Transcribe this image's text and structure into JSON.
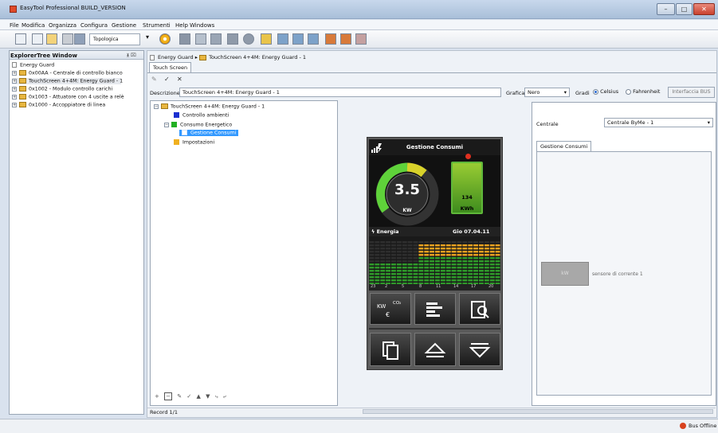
{
  "window": {
    "title": "EasyTool Professional BUILD_VERSION",
    "controls": [
      "–",
      "□",
      "✕"
    ]
  },
  "menu": [
    "File",
    "Modifica",
    "Organizza",
    "Configura",
    "Gestione",
    "Strumenti",
    "Help",
    "Windows"
  ],
  "toolbar": {
    "view_combo": "Topologica",
    "icons": [
      "new-file-icon",
      "open-file-icon",
      "folder-icon",
      "delete-icon",
      "save-icon",
      "target-icon",
      "grid-icon",
      "asterisk-icon",
      "network-icon",
      "block-icon",
      "circle-icon",
      "download-icon",
      "device-left-icon",
      "device-mid-icon",
      "device-cross-icon",
      "compare-icon",
      "export-icon",
      "import-icon"
    ]
  },
  "explorer": {
    "title": "ExplorerTree Window",
    "pin": "ᚕ ⌧",
    "root": "Energy Guard",
    "items": [
      "0x00AA - Centrale di controllo bianco",
      "TouchScreen 4+4M: Energy Guard - 1",
      "0x1002 - Modulo controllo carichi",
      "0x1003 - Attuatore con 4 uscite a relè",
      "0x1000 - Accoppiatore di linea"
    ]
  },
  "breadcrumb": {
    "root": "Energy Guard",
    "separator": "▸",
    "current": "TouchScreen 4+4M: Energy Guard - 1"
  },
  "doc_tab": "Touch Screen",
  "edit_toolbar": [
    "✎",
    "✓",
    "✕"
  ],
  "form": {
    "descrizione_label": "Descrizione",
    "descrizione_value": "TouchScreen 4+4M: Energy Guard - 1",
    "grafica_label": "Grafica",
    "grafica_value": "Nero",
    "gradi_label": "Gradi",
    "celsius": "Celsius",
    "fahrenheit": "Fahrenheit",
    "interface_button": "Interfaccia BUS"
  },
  "page_tree": {
    "root": "TouchScreen 4+4M: Energy Guard - 1",
    "items": [
      {
        "label": "Controllo ambienti",
        "color": "#1a2fd0"
      },
      {
        "label": "Consumo Energetico",
        "color": "#22b022"
      },
      {
        "label": "Gestione Consumi",
        "color": "#ffffff"
      },
      {
        "label": "Impostazioni",
        "color": "#f0b020"
      }
    ],
    "footer_tools": [
      "+",
      "−",
      "✎",
      "✓",
      "▲",
      "▼",
      "⤷",
      "⤶"
    ]
  },
  "device": {
    "header": "Gestione Consumi",
    "power_value": "3.5",
    "power_unit": "KW",
    "battery_value": "134",
    "battery_unit": "KWh",
    "energy_label": "Energia",
    "date": "Gio 07.04.11",
    "axis_ticks": [
      "23",
      "2",
      "5",
      "8",
      "11",
      "14",
      "17",
      "20"
    ],
    "buttons": [
      "kw-co2-euro-icon",
      "bar-chart-icon",
      "report-search-icon",
      "copy-pages-icon",
      "up-triangle-icon",
      "down-triangle-icon"
    ],
    "kw_label": "KW",
    "co2_label": "CO₂",
    "euro_label": "€"
  },
  "right_panel": {
    "centrale_label": "Centrale",
    "centrale_value": "Centrale ByMe - 1",
    "tab": "Gestione Consumi",
    "sensor_label": "sensore di corrente 1",
    "sensor_icon_label": "kW"
  },
  "record": "Record 1/1",
  "status": "Bus Offline"
}
